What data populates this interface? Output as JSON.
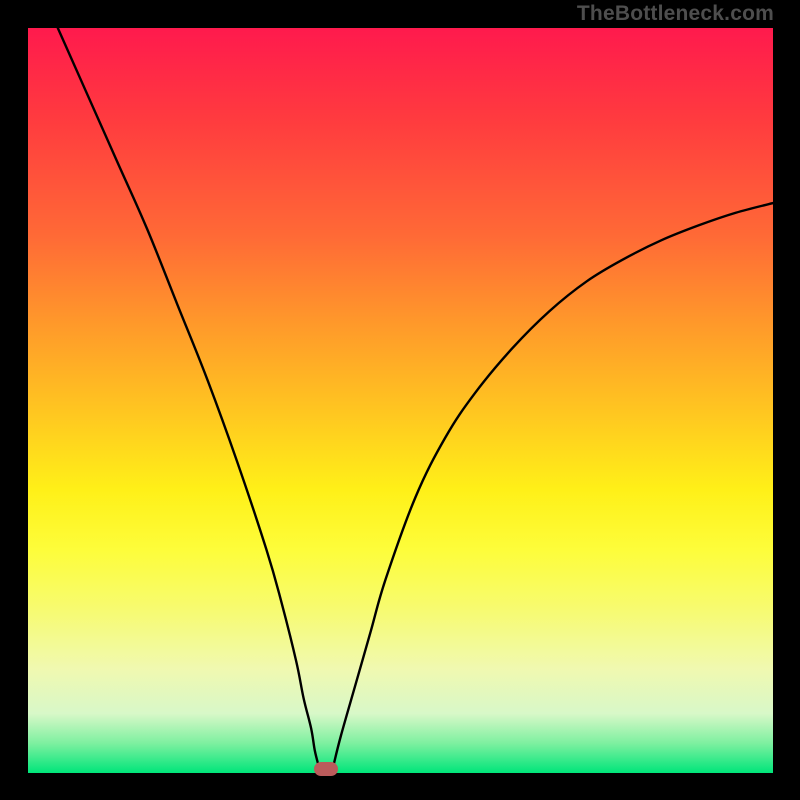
{
  "watermark_text": "TheBottleneck.com",
  "colors": {
    "frame": "#000000",
    "gradient_top": "#ff1a4d",
    "gradient_bottom": "#00e57a",
    "curve_stroke": "#000000",
    "marker": "#bb5b5b",
    "watermark": "#4e4e4e"
  },
  "chart_data": {
    "type": "line",
    "title": "",
    "xlabel": "",
    "ylabel": "",
    "xlim": [
      0,
      100
    ],
    "ylim": [
      0,
      100
    ],
    "grid": false,
    "legend": "none",
    "annotations": [
      {
        "type": "marker",
        "x": 40,
        "y": 0.5,
        "shape": "rounded-rect",
        "color": "#bb5b5b"
      }
    ],
    "series": [
      {
        "name": "left-branch",
        "x": [
          4,
          8,
          12,
          16,
          20,
          24,
          28,
          32,
          34,
          36,
          37,
          38,
          38.5,
          39
        ],
        "values": [
          100,
          91,
          82,
          73,
          63,
          53,
          42,
          30,
          23,
          15,
          10,
          6,
          3,
          1
        ]
      },
      {
        "name": "right-branch",
        "x": [
          41,
          42,
          44,
          46,
          48,
          52,
          56,
          60,
          65,
          70,
          75,
          80,
          85,
          90,
          95,
          100
        ],
        "values": [
          1,
          5,
          12,
          19,
          26,
          37,
          45,
          51,
          57,
          62,
          66,
          69,
          71.5,
          73.5,
          75.2,
          76.5
        ]
      }
    ]
  }
}
